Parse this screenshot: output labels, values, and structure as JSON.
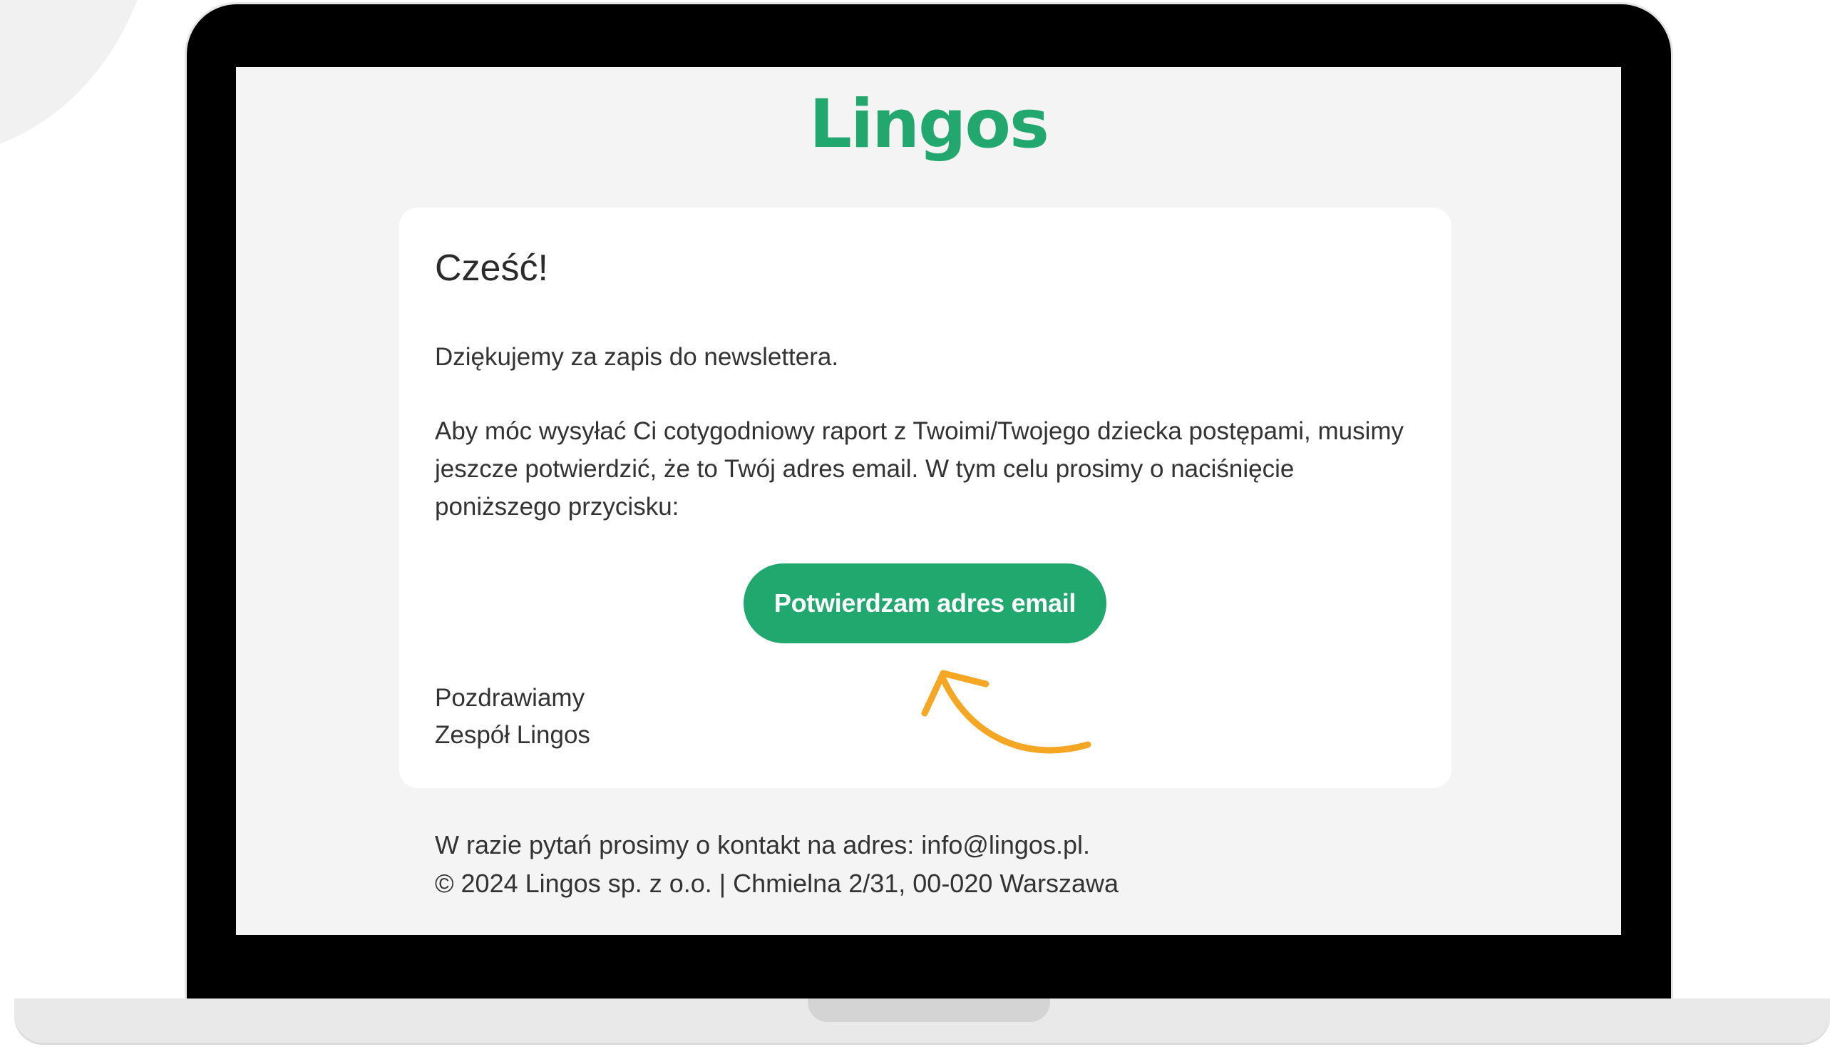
{
  "email": {
    "logo_text": "Lingos",
    "greeting": "Cześć!",
    "paragraph_1": "Dziękujemy za zapis do newslettera.",
    "paragraph_2": "Aby móc wysyłać Ci cotygodniowy raport z Twoimi/Twojego dziecka postępami, musimy jeszcze potwierdzić, że to Twój adres email. W tym celu prosimy o naciśnięcie poniższego przycisku:",
    "confirm_button_label": "Potwierdzam adres email",
    "signoff_line_1": "Pozdrawiamy",
    "signoff_line_2": "Zespół Lingos"
  },
  "footer": {
    "contact_line": "W razie pytań prosimy o kontakt na adres: info@lingos.pl.",
    "copyright_line": "© 2024 Lingos sp. z o.o. | Chmielna 2/31, 00-020 Warszawa"
  },
  "icons": {
    "pointer": "curved-arrow-icon"
  },
  "colors": {
    "brand_green": "#21a86f",
    "arrow_orange": "#f5a623",
    "screen_background": "#f4f4f4",
    "card_background": "#ffffff",
    "laptop_bezel": "#000000"
  }
}
